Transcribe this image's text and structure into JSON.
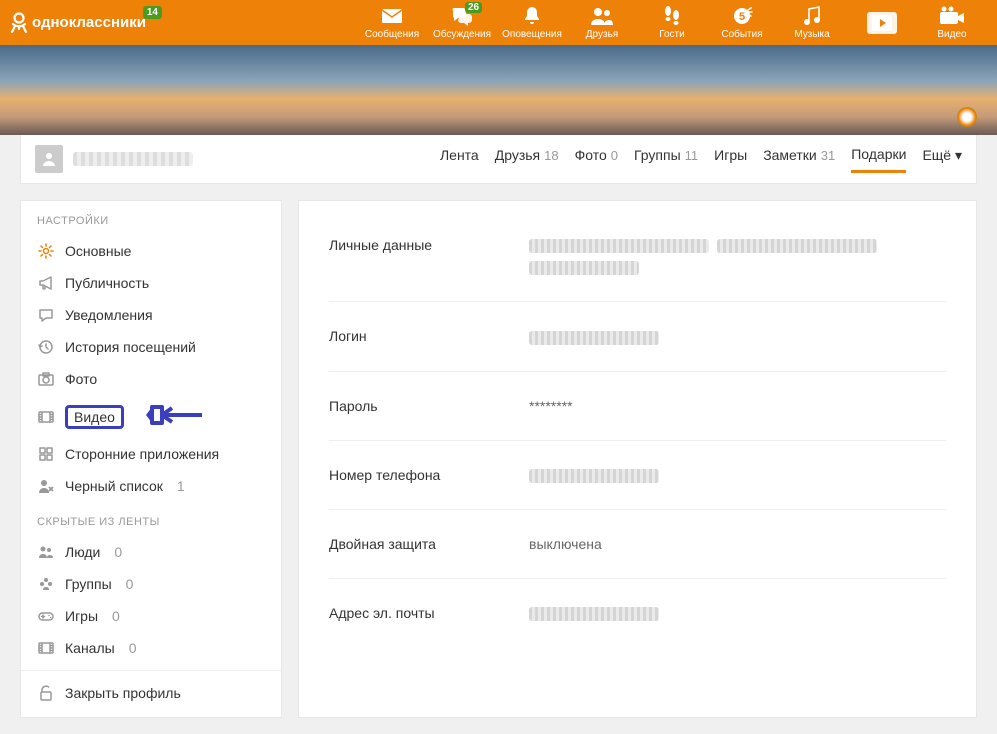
{
  "topbar": {
    "brand": "одноклассники",
    "brand_badge": "14",
    "items": [
      {
        "label": "Сообщения",
        "icon": "mail"
      },
      {
        "label": "Обсуждения",
        "icon": "chat",
        "badge": "26"
      },
      {
        "label": "Оповещения",
        "icon": "bell"
      },
      {
        "label": "Друзья",
        "icon": "people"
      },
      {
        "label": "Гости",
        "icon": "footprints"
      },
      {
        "label": "События",
        "icon": "calendar"
      },
      {
        "label": "Музыка",
        "icon": "music"
      },
      {
        "label": "",
        "icon": "play",
        "active": true
      },
      {
        "label": "Видео",
        "icon": "camera"
      }
    ]
  },
  "profile": {
    "tabs": [
      {
        "label": "Лента",
        "count": ""
      },
      {
        "label": "Друзья",
        "count": "18"
      },
      {
        "label": "Фото",
        "count": "0"
      },
      {
        "label": "Группы",
        "count": "11"
      },
      {
        "label": "Игры",
        "count": ""
      },
      {
        "label": "Заметки",
        "count": "31"
      },
      {
        "label": "Подарки",
        "count": "",
        "active": true
      },
      {
        "label": "Ещё ▾",
        "count": ""
      }
    ]
  },
  "sidebar": {
    "heading1": "НАСТРОЙКИ",
    "items1": [
      {
        "label": "Основные",
        "icon": "gear",
        "active": true
      },
      {
        "label": "Публичность",
        "icon": "megaphone"
      },
      {
        "label": "Уведомления",
        "icon": "chat2"
      },
      {
        "label": "История посещений",
        "icon": "history"
      },
      {
        "label": "Фото",
        "icon": "photo"
      },
      {
        "label": "Видео",
        "icon": "film",
        "highlighted": true
      },
      {
        "label": "Сторонние приложения",
        "icon": "puzzle"
      },
      {
        "label": "Черный список",
        "icon": "blacklist",
        "count": "1"
      }
    ],
    "heading2": "СКРЫТЫЕ ИЗ ЛЕНТЫ",
    "items2": [
      {
        "label": "Люди",
        "icon": "people",
        "count": "0"
      },
      {
        "label": "Группы",
        "icon": "groups",
        "count": "0"
      },
      {
        "label": "Игры",
        "icon": "gamepad",
        "count": "0"
      },
      {
        "label": "Каналы",
        "icon": "film",
        "count": "0"
      }
    ],
    "close_profile": "Закрыть профиль"
  },
  "settings_rows": [
    {
      "label": "Личные данные",
      "type": "blur2"
    },
    {
      "label": "Логин",
      "type": "blur1"
    },
    {
      "label": "Пароль",
      "value": "********"
    },
    {
      "label": "Номер телефона",
      "type": "blur1"
    },
    {
      "label": "Двойная защита",
      "value": "выключена"
    },
    {
      "label": "Адрес эл. почты",
      "type": "blur1"
    }
  ]
}
